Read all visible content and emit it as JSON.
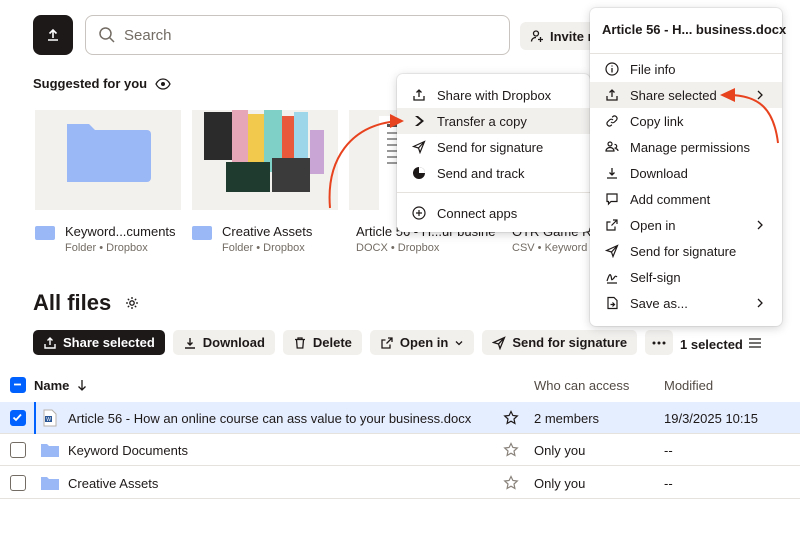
{
  "topbar": {
    "search_placeholder": "Search",
    "invite_label": "Invite m"
  },
  "suggested": {
    "title": "Suggested for you",
    "cards": [
      {
        "title": "Keyword...cuments",
        "sub": "Folder • Dropbox"
      },
      {
        "title": "Creative Assets",
        "sub": "Folder • Dropbox"
      },
      {
        "title": "Article 56 - H...ur busine",
        "sub": "DOCX • Dropbox"
      },
      {
        "title": "OTR Game Re",
        "sub": "CSV • Keyword D"
      }
    ]
  },
  "files": {
    "title": "All files",
    "toolbar": {
      "share": "Share selected",
      "download": "Download",
      "delete": "Delete",
      "open_in": "Open in",
      "send_sig": "Send for signature"
    },
    "selected_count": "1 selected",
    "columns": {
      "name": "Name",
      "access": "Who can access",
      "modified": "Modified"
    },
    "rows": [
      {
        "name": "Article 56 - How an online course can ass value to your business.docx",
        "access": "2 members",
        "modified": "19/3/2025 10:15"
      },
      {
        "name": "Keyword Documents",
        "access": "Only you",
        "modified": "--"
      },
      {
        "name": "Creative Assets",
        "access": "Only you",
        "modified": "--"
      }
    ]
  },
  "context_menu": {
    "title": "Article 56 - H... business.docx",
    "items": [
      {
        "label": "File info",
        "icon": "info-icon"
      },
      {
        "label": "Share selected",
        "icon": "share-icon"
      },
      {
        "label": "Copy link",
        "icon": "link-icon"
      },
      {
        "label": "Manage permissions",
        "icon": "people-icon"
      },
      {
        "label": "Download",
        "icon": "download-icon"
      },
      {
        "label": "Add comment",
        "icon": "comment-icon"
      },
      {
        "label": "Open in",
        "icon": "open-in-icon"
      },
      {
        "label": "Send for signature",
        "icon": "signature-icon"
      },
      {
        "label": "Self-sign",
        "icon": "self-sign-icon"
      },
      {
        "label": "Save as...",
        "icon": "save-as-icon"
      }
    ]
  },
  "share_submenu": {
    "items": [
      {
        "label": "Share with Dropbox",
        "icon": "share-icon"
      },
      {
        "label": "Transfer a copy",
        "icon": "transfer-icon"
      },
      {
        "label": "Send for signature",
        "icon": "signature-icon"
      },
      {
        "label": "Send and track",
        "icon": "track-icon"
      },
      {
        "label": "Connect apps",
        "icon": "plus-circle-icon"
      }
    ]
  },
  "colors": {
    "accent": "#0061fe",
    "arrow": "#e8431f",
    "dark": "#1e1919",
    "folder": "#9ab8f5"
  }
}
